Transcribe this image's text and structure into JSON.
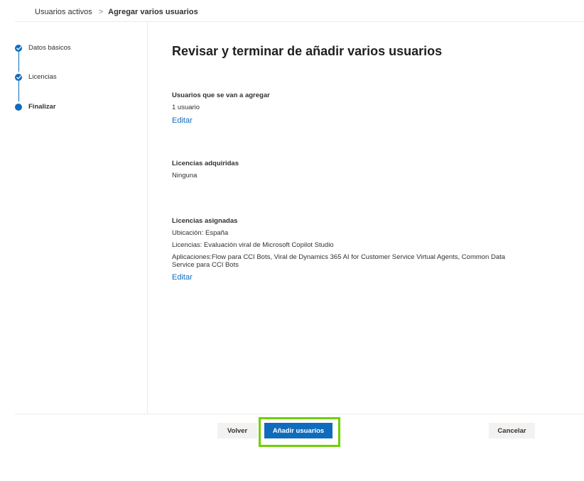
{
  "breadcrumb": {
    "parent": "Usuarios activos",
    "separator": ">",
    "current": "Agregar varios usuarios"
  },
  "stepper": {
    "steps": [
      {
        "label": "Datos básicos",
        "status": "completed"
      },
      {
        "label": "Licencias",
        "status": "completed"
      },
      {
        "label": "Finalizar",
        "status": "current"
      }
    ]
  },
  "main": {
    "title": "Revisar y terminar de añadir varios usuarios",
    "sections": [
      {
        "heading": "Usuarios que se van a agregar",
        "lines": [
          "1 usuario"
        ],
        "edit_label": "Editar"
      },
      {
        "heading": "Licencias adquiridas",
        "lines": [
          "Ninguna"
        ]
      },
      {
        "heading": "Licencias asignadas",
        "lines": [
          "Ubicación: España",
          "Licencias: Evaluación viral de Microsoft Copilot Studio",
          "Aplicaciones:Flow para CCI Bots, Viral de Dynamics 365 AI for Customer Service Virtual Agents, Common Data Service para CCI Bots"
        ],
        "edit_label": "Editar"
      }
    ]
  },
  "footer": {
    "back_label": "Volver",
    "add_label": "Añadir usuarios",
    "cancel_label": "Cancelar"
  },
  "colors": {
    "accent": "#0f6cbd",
    "highlight": "#6fcf00"
  }
}
